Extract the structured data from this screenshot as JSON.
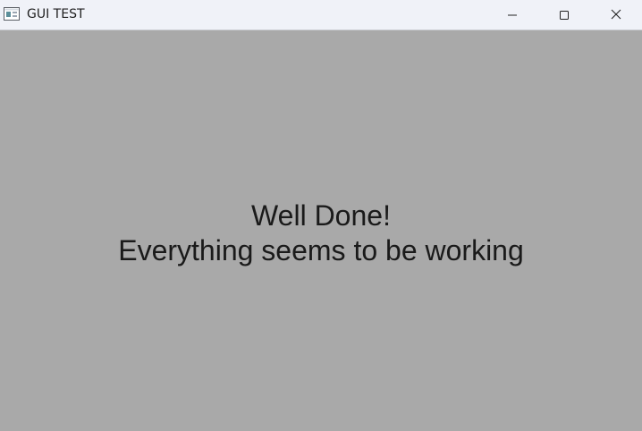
{
  "window": {
    "title": "GUI TEST",
    "icon": "app-window-icon"
  },
  "title_controls": {
    "minimize_icon": "minimize-icon",
    "maximize_icon": "maximize-icon",
    "close_icon": "close-icon"
  },
  "content": {
    "line1": "Well Done!",
    "line2": "Everything seems to be working"
  },
  "colors": {
    "titlebar_background": "#f0f2f8",
    "content_background": "#a9a9a9",
    "text": "#1a1a1a"
  }
}
